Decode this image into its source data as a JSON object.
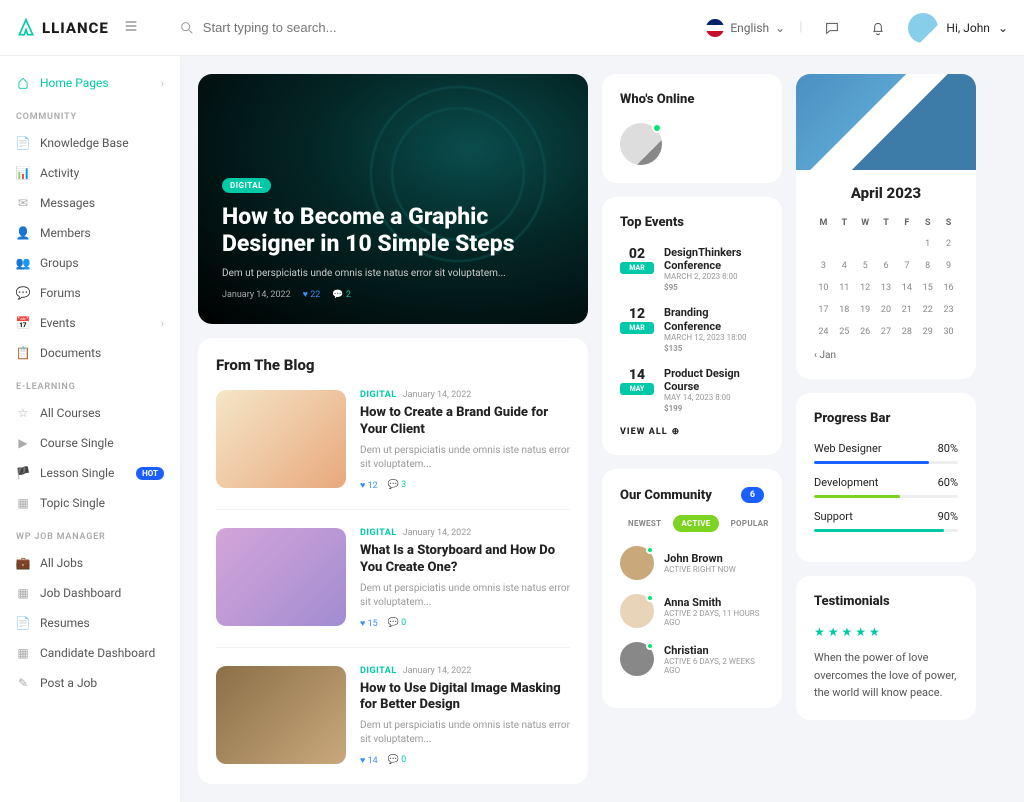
{
  "brand": "LLIANCE",
  "search": {
    "placeholder": "Start typing to search..."
  },
  "language": "English",
  "user": {
    "greeting": "Hi, John"
  },
  "sidebar": {
    "home": "Home Pages",
    "sections": {
      "community": {
        "heading": "COMMUNITY",
        "items": [
          "Knowledge Base",
          "Activity",
          "Messages",
          "Members",
          "Groups",
          "Forums",
          "Events",
          "Documents"
        ]
      },
      "elearning": {
        "heading": "E-LEARNING",
        "items": [
          "All Courses",
          "Course Single",
          "Lesson Single",
          "Topic Single"
        ],
        "hot": "HOT"
      },
      "jobs": {
        "heading": "WP JOB MANAGER",
        "items": [
          "All Jobs",
          "Job Dashboard",
          "Resumes",
          "Candidate Dashboard",
          "Post a Job"
        ]
      }
    }
  },
  "hero": {
    "tag": "DIGITAL",
    "title": "How to Become a Graphic Designer in 10 Simple Steps",
    "desc": "Dem ut perspiciatis unde omnis iste natus error sit voluptatem...",
    "date": "January 14, 2022",
    "likes": "22",
    "comments": "2"
  },
  "blog": {
    "title": "From The Blog",
    "posts": [
      {
        "cat": "DIGITAL",
        "date": "January 14, 2022",
        "title": "How to Create a Brand Guide for Your Client",
        "desc": "Dem ut perspiciatis unde omnis iste natus error sit voluptatem...",
        "likes": "12",
        "comments": "3"
      },
      {
        "cat": "DIGITAL",
        "date": "January 14, 2022",
        "title": "What Is a Storyboard and How Do You Create One?",
        "desc": "Dem ut perspiciatis unde omnis iste natus error sit voluptatem...",
        "likes": "15",
        "comments": "0"
      },
      {
        "cat": "DIGITAL",
        "date": "January 14, 2022",
        "title": "How to Use Digital Image Masking for Better Design",
        "desc": "Dem ut perspiciatis unde omnis iste natus error sit voluptatem...",
        "likes": "14",
        "comments": "0"
      }
    ]
  },
  "online": {
    "title": "Who's Online"
  },
  "events": {
    "title": "Top Events",
    "items": [
      {
        "day": "02",
        "month": "MAR",
        "title": "DesignThinkers Conference",
        "meta": "MARCH 2, 2023 8:00",
        "price": "$95"
      },
      {
        "day": "12",
        "month": "MAR",
        "title": "Branding Conference",
        "meta": "MARCH 12, 2023 18:00",
        "price": "$135"
      },
      {
        "day": "14",
        "month": "MAY",
        "title": "Product Design Course",
        "meta": "MAY 14, 2023 8:00",
        "price": "$199"
      }
    ],
    "viewAll": "VIEW ALL"
  },
  "community": {
    "title": "Our Community",
    "count": "6",
    "filters": [
      "NEWEST",
      "ACTIVE",
      "POPULAR"
    ],
    "members": [
      {
        "name": "John Brown",
        "status": "ACTIVE RIGHT NOW"
      },
      {
        "name": "Anna Smith",
        "status": "ACTIVE 2 DAYS, 11 HOURS AGO"
      },
      {
        "name": "Christian",
        "status": "ACTIVE 6 DAYS, 2 WEEKS AGO"
      }
    ]
  },
  "calendar": {
    "title": "April 2023",
    "heads": [
      "M",
      "T",
      "W",
      "T",
      "F",
      "S",
      "S"
    ],
    "prev": "Jan"
  },
  "progress": {
    "title": "Progress Bar",
    "items": [
      {
        "label": "Web Designer",
        "pct": "80%",
        "color": "#1a5fff",
        "width": "80%"
      },
      {
        "label": "Development",
        "pct": "60%",
        "color": "#7dd321",
        "width": "60%"
      },
      {
        "label": "Support",
        "pct": "90%",
        "color": "#00c9a7",
        "width": "90%"
      }
    ]
  },
  "testimonials": {
    "title": "Testimonials",
    "quote": "When the power of love overcomes the love of power, the world will know peace."
  }
}
